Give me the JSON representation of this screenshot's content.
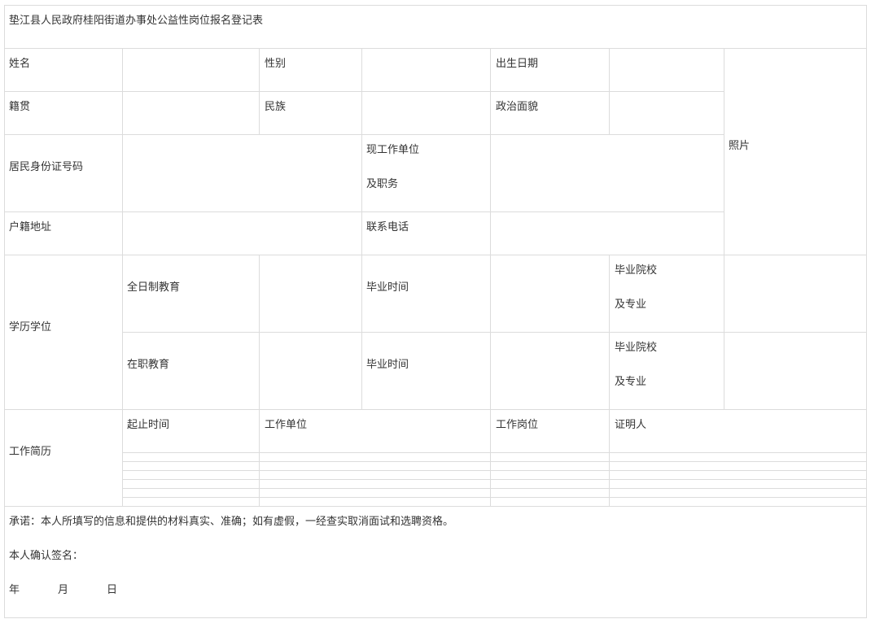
{
  "form": {
    "title": "垫江县人民政府桂阳街道办事处公益性岗位报名登记表",
    "labels": {
      "name": "姓名",
      "gender": "性别",
      "birth_date": "出生日期",
      "photo": "照片",
      "native_place": "籍贯",
      "ethnicity": "民族",
      "political_status": "政治面貌",
      "id_number": "居民身份证号码",
      "current_employer_line1": "现工作单位",
      "current_employer_line2": "及职务",
      "household_address": "户籍地址",
      "phone": "联系电话",
      "education": "学历学位",
      "fulltime_edu": "全日制教育",
      "graduation_time": "毕业时间",
      "school_line1": "毕业院校",
      "school_line2": "及专业",
      "inservice_edu": "在职教育",
      "work_history": "工作简历",
      "period": "起止时间",
      "work_unit": "工作单位",
      "work_post": "工作岗位",
      "witness": "证明人"
    },
    "declaration": {
      "promise": "承诺：本人所填写的信息和提供的材料真实、准确；如有虚假，一经查实取消面试和选聘资格。",
      "signature": "本人确认签名：",
      "year": "年",
      "month": "月",
      "day": "日"
    }
  }
}
